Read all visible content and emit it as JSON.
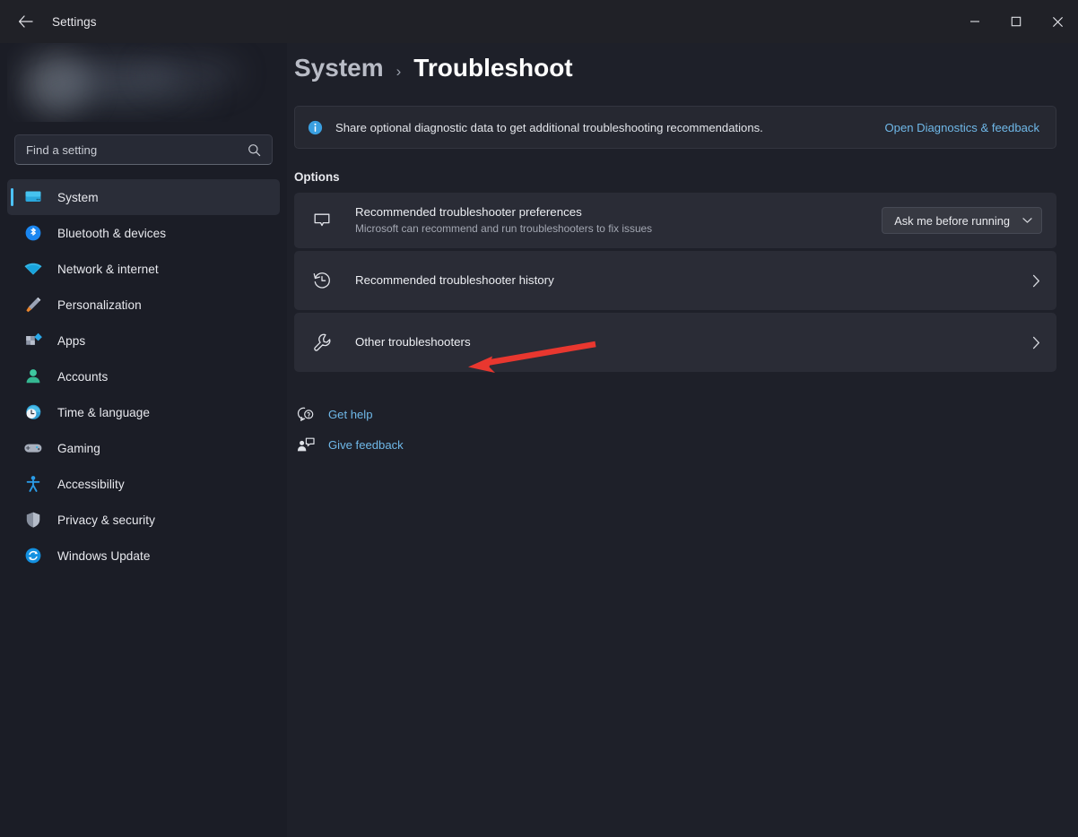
{
  "window": {
    "app_title": "Settings",
    "back_icon": "back-arrow-icon",
    "minimize_label": "Minimize",
    "maximize_label": "Maximize",
    "close_label": "Close"
  },
  "sidebar": {
    "search": {
      "placeholder": "Find a setting",
      "icon": "search-icon"
    },
    "items": [
      {
        "label": "System",
        "icon": "monitor-icon",
        "selected": true
      },
      {
        "label": "Bluetooth & devices",
        "icon": "bluetooth-icon",
        "selected": false
      },
      {
        "label": "Network & internet",
        "icon": "wifi-icon",
        "selected": false
      },
      {
        "label": "Personalization",
        "icon": "paintbrush-icon",
        "selected": false
      },
      {
        "label": "Apps",
        "icon": "apps-icon",
        "selected": false
      },
      {
        "label": "Accounts",
        "icon": "person-icon",
        "selected": false
      },
      {
        "label": "Time & language",
        "icon": "clock-globe-icon",
        "selected": false
      },
      {
        "label": "Gaming",
        "icon": "gamepad-icon",
        "selected": false
      },
      {
        "label": "Accessibility",
        "icon": "accessibility-icon",
        "selected": false
      },
      {
        "label": "Privacy & security",
        "icon": "shield-icon",
        "selected": false
      },
      {
        "label": "Windows Update",
        "icon": "update-refresh-icon",
        "selected": false
      }
    ]
  },
  "breadcrumb": {
    "root": "System",
    "separator": "›",
    "leaf": "Troubleshoot"
  },
  "banner": {
    "icon": "info-icon",
    "text": "Share optional diagnostic data to get additional troubleshooting recommendations.",
    "link": "Open Diagnostics & feedback"
  },
  "options": {
    "section_title": "Options",
    "rows": [
      {
        "icon": "message-bubble-icon",
        "title": "Recommended troubleshooter preferences",
        "subtitle": "Microsoft can recommend and run troubleshooters to fix issues",
        "control": "dropdown",
        "dropdown_value": "Ask me before running",
        "dropdown_icon": "chevron-down-icon"
      },
      {
        "icon": "history-icon",
        "title": "Recommended troubleshooter history",
        "subtitle": "",
        "control": "chevron",
        "chevron_icon": "chevron-right-icon"
      },
      {
        "icon": "wrench-icon",
        "title": "Other troubleshooters",
        "subtitle": "",
        "control": "chevron",
        "chevron_icon": "chevron-right-icon"
      }
    ]
  },
  "footer_links": [
    {
      "label": "Get help",
      "icon": "help-question-icon"
    },
    {
      "label": "Give feedback",
      "icon": "feedback-person-icon"
    }
  ],
  "annotation": {
    "type": "arrow",
    "color": "#e8372f",
    "points_to": "Other troubleshooters"
  },
  "colors": {
    "accent": "#4cc2ff",
    "link": "#6fb8e8",
    "card_bg": "#2a2c36",
    "page_bg": "#1e2029",
    "sidebar_bg": "#1b1d26",
    "annotation_red": "#e8372f"
  }
}
